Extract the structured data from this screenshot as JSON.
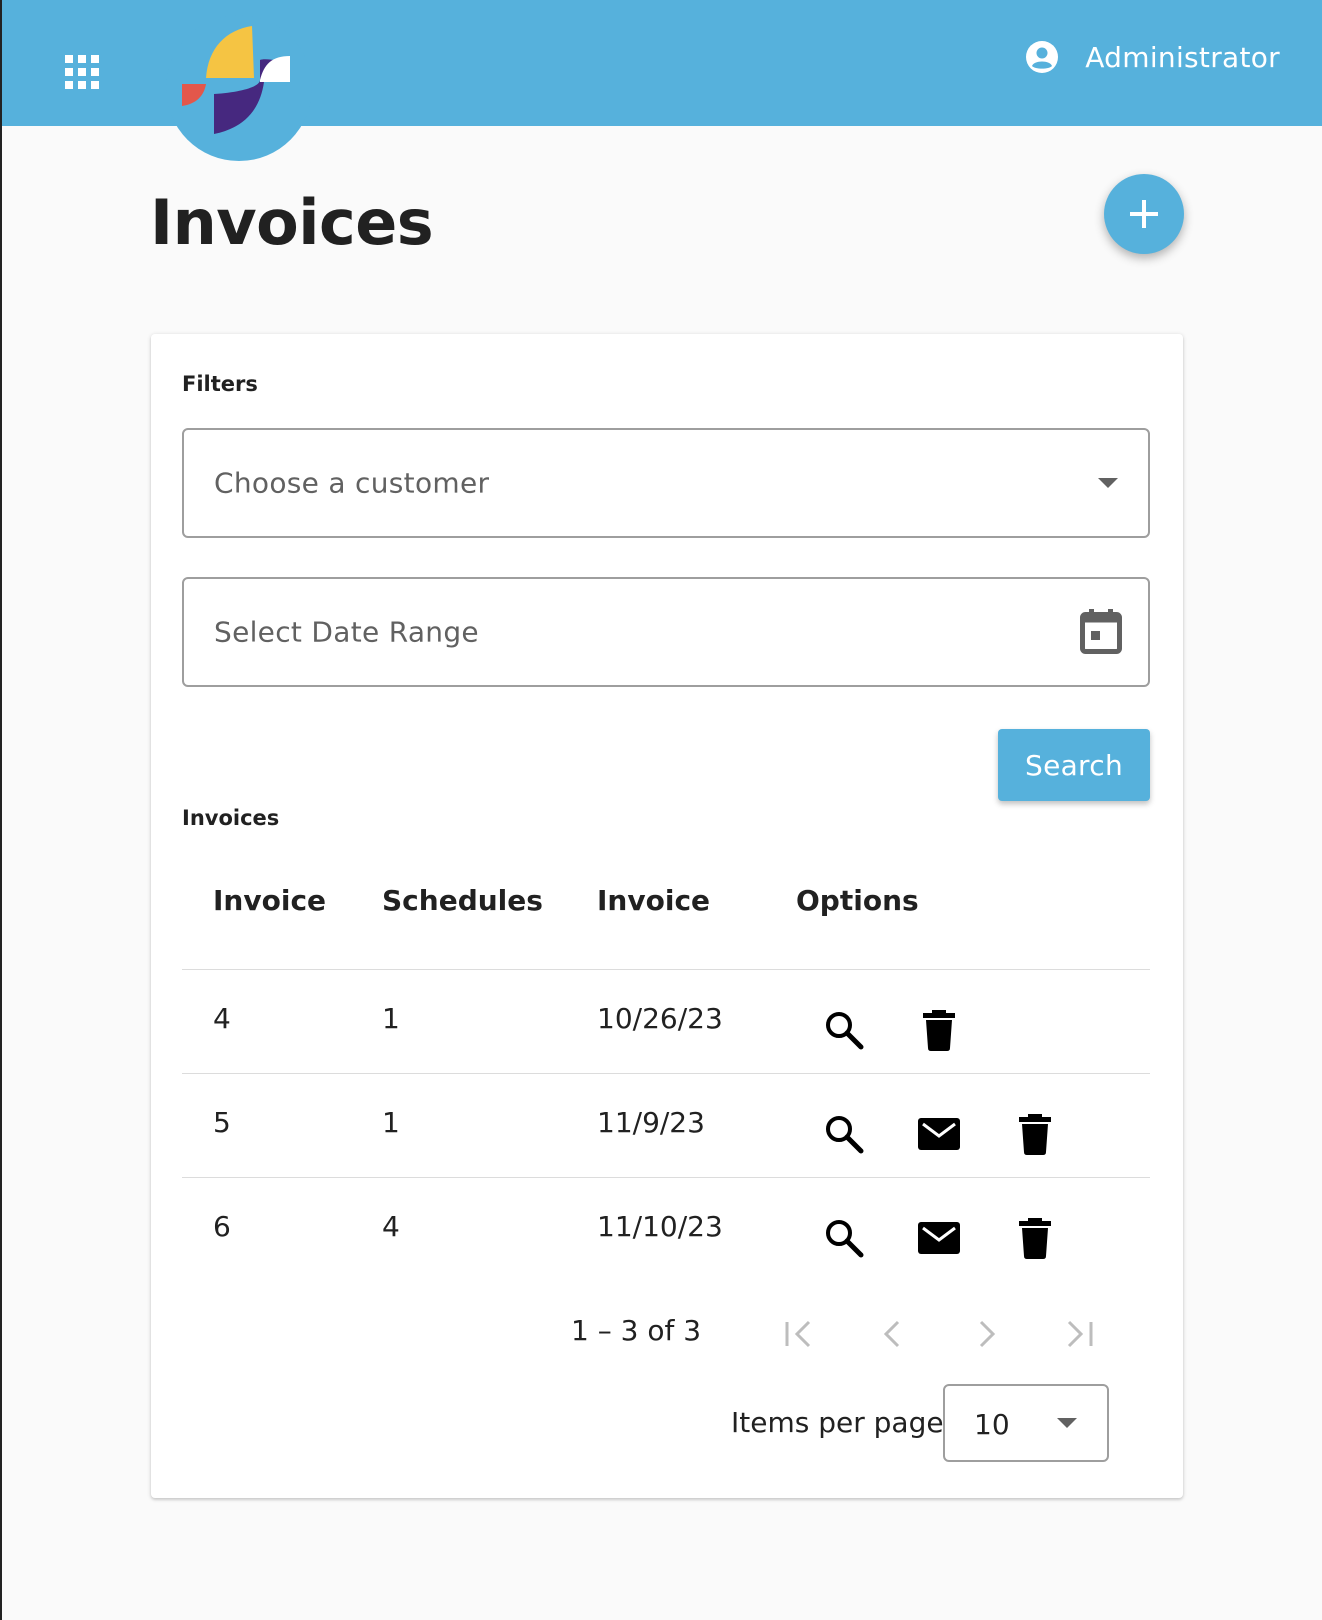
{
  "header": {
    "user_name": "Administrator"
  },
  "page": {
    "title": "Invoices"
  },
  "filters": {
    "label": "Filters",
    "customer_placeholder": "Choose a customer",
    "date_range_placeholder": "Select Date Range",
    "search_label": "Search"
  },
  "invoices": {
    "label": "Invoices",
    "columns": [
      "Invoice",
      "Schedules",
      "Invoice",
      "Options"
    ],
    "rows": [
      {
        "invoice": "4",
        "schedules": "1",
        "date": "10/26/23",
        "options": [
          "search-icon",
          "delete-icon"
        ]
      },
      {
        "invoice": "5",
        "schedules": "1",
        "date": "11/9/23",
        "options": [
          "search-icon",
          "mail-icon",
          "delete-icon"
        ]
      },
      {
        "invoice": "6",
        "schedules": "4",
        "date": "11/10/23",
        "options": [
          "search-icon",
          "mail-icon",
          "delete-icon"
        ]
      }
    ]
  },
  "paginator": {
    "range": "1 – 3 of 3",
    "items_per_page_label": "Items per page",
    "items_per_page_value": "10"
  },
  "colors": {
    "primary": "#56b1dc",
    "logo_yellow": "#f5c443",
    "logo_purple": "#46287f",
    "logo_red": "#e3574b"
  }
}
